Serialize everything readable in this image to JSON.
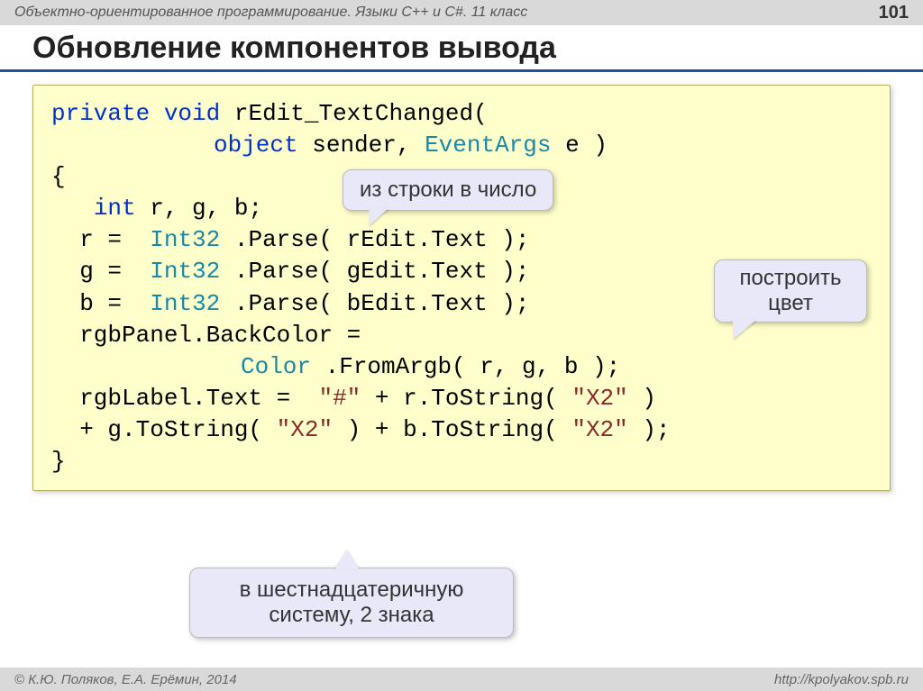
{
  "header": {
    "course": "Объектно-ориентированное программирование. Языки C++ и C#. 11 класс",
    "page": "101"
  },
  "title": "Обновление компонентов вывода",
  "code": {
    "l1a": "private",
    "l1b": "void",
    "l1c": " rEdit_TextChanged(",
    "l2a": "object",
    "l2b": " sender, ",
    "l2c": "EventArgs",
    "l2d": " e )",
    "l3": "{",
    "l4a": "int",
    "l4b": " r, g, b;",
    "l5a": "  r = ",
    "l5b": "Int32",
    "l5c": ".Parse( rEdit.Text );",
    "l6a": "  g = ",
    "l6b": "Int32",
    "l6c": ".Parse( gEdit.Text );",
    "l7a": "  b = ",
    "l7b": "Int32",
    "l7c": ".Parse( bEdit.Text );",
    "l8": "  rgbPanel.BackColor =",
    "l9a": "Color",
    "l9b": ".FromArgb( r, g, b );",
    "l10a": "  rgbLabel.Text = ",
    "l10b": "\"#\"",
    "l10c": " + r.ToString(",
    "l10d": "\"X2\"",
    "l10e": ")",
    "l11a": "  + g.ToString(",
    "l11b": "\"X2\"",
    "l11c": ") + b.ToString(",
    "l11d": "\"X2\"",
    "l11e": ");",
    "l12": "}"
  },
  "callouts": {
    "parse": "из строки в число",
    "color": "построить цвет",
    "hex": "в шестнадцатеричную систему, 2 знака"
  },
  "footer": {
    "credits": "© К.Ю. Поляков, Е.А. Ерёмин, 2014",
    "url": "http://kpolyakov.spb.ru"
  }
}
